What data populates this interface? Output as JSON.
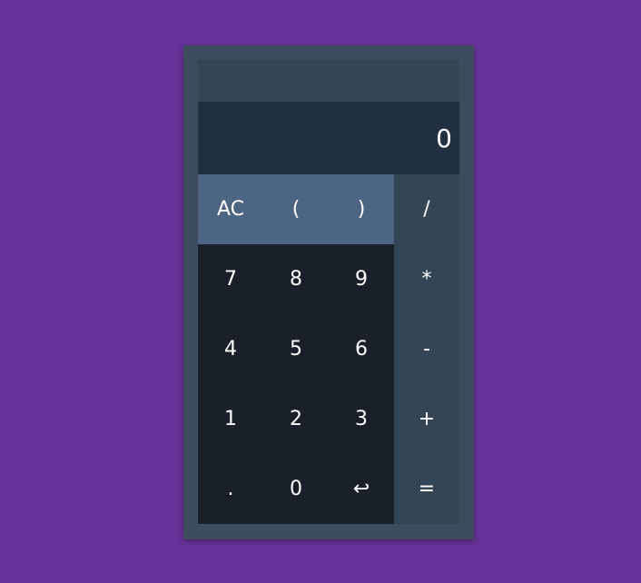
{
  "colors": {
    "background": "#663399",
    "calculator_frame": "#3d4d5f",
    "screen_top": "#344655",
    "screen_main": "#223142",
    "function_row": "#4d6482",
    "number_pad": "#1a2029",
    "operator_column": "#344655",
    "text": "#ffffff"
  },
  "display": {
    "value": "0"
  },
  "keys": {
    "function_row": [
      {
        "label": "AC",
        "name": "all-clear-button"
      },
      {
        "label": "(",
        "name": "open-paren-button"
      },
      {
        "label": ")",
        "name": "close-paren-button"
      }
    ],
    "operators": [
      {
        "label": "/",
        "name": "divide-button"
      },
      {
        "label": "*",
        "name": "multiply-button"
      },
      {
        "label": "-",
        "name": "subtract-button"
      },
      {
        "label": "+",
        "name": "add-button"
      },
      {
        "label": "=",
        "name": "equals-button"
      }
    ],
    "numbers": [
      {
        "label": "7",
        "name": "digit-7-button"
      },
      {
        "label": "8",
        "name": "digit-8-button"
      },
      {
        "label": "9",
        "name": "digit-9-button"
      },
      {
        "label": "4",
        "name": "digit-4-button"
      },
      {
        "label": "5",
        "name": "digit-5-button"
      },
      {
        "label": "6",
        "name": "digit-6-button"
      },
      {
        "label": "1",
        "name": "digit-1-button"
      },
      {
        "label": "2",
        "name": "digit-2-button"
      },
      {
        "label": "3",
        "name": "digit-3-button"
      },
      {
        "label": ".",
        "name": "decimal-point-button"
      },
      {
        "label": "0",
        "name": "digit-0-button"
      },
      {
        "label": "↩",
        "name": "backspace-button"
      }
    ]
  }
}
